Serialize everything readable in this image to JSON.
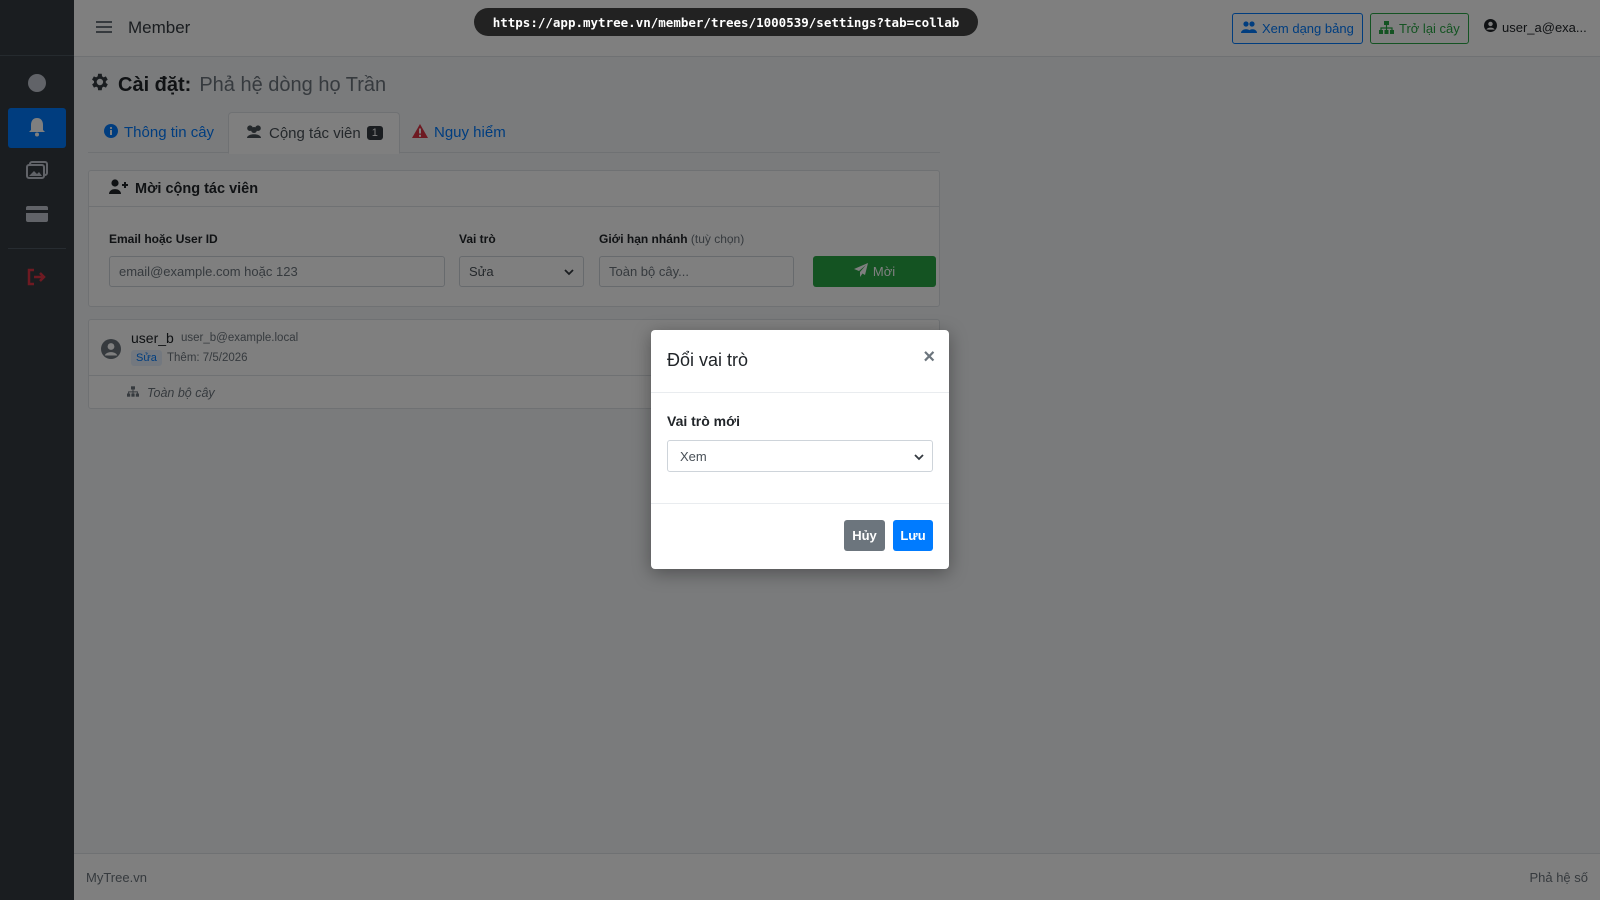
{
  "topbar": {
    "title": "Member",
    "url": "https://app.mytree.vn/member/trees/1000539/settings?tab=collab",
    "table_view_label": "Xem dạng bảng",
    "back_to_tree_label": "Trở lại cây",
    "user_label": "user_a@exa..."
  },
  "sidebar": {
    "items": [
      {
        "icon": "circle-icon"
      },
      {
        "icon": "bell-icon",
        "active": true
      },
      {
        "icon": "images-icon"
      },
      {
        "icon": "credit-card-icon"
      },
      {
        "icon": "sign-out-icon"
      }
    ]
  },
  "page": {
    "heading_label": "Cài đặt:",
    "tree_name": "Phả hệ dòng họ Trần"
  },
  "tabs": [
    {
      "label": "Thông tin cây"
    },
    {
      "label": "Cộng tác viên",
      "badge": "1"
    },
    {
      "label": "Nguy hiểm"
    }
  ],
  "invite": {
    "header": "Mời cộng tác viên",
    "email_label": "Email hoặc User ID",
    "email_placeholder": "email@example.com hoặc 123",
    "role_label": "Vai trò",
    "role_value": "Sửa",
    "branch_label": "Giới hạn nhánh",
    "branch_optional": "(tuỳ chọn)",
    "branch_placeholder": "Toàn bộ cây...",
    "submit_label": "Mời"
  },
  "members": [
    {
      "name": "user_b",
      "email": "user_b@example.local",
      "role": "Sửa",
      "added": "Thêm: 7/5/2026",
      "scope": "Toàn bộ cây"
    }
  ],
  "footer": {
    "left": "MyTree.vn",
    "right": "Phả hệ số"
  },
  "modal": {
    "title": "Đổi vai trò",
    "close": "×",
    "field_label": "Vai trò mới",
    "selected_role": "Xem",
    "cancel_label": "Hủy",
    "save_label": "Lưu"
  },
  "colors": {
    "primary": "#007bff",
    "success": "#28a745",
    "danger": "#dc3545",
    "sidebar": "#343a40"
  }
}
